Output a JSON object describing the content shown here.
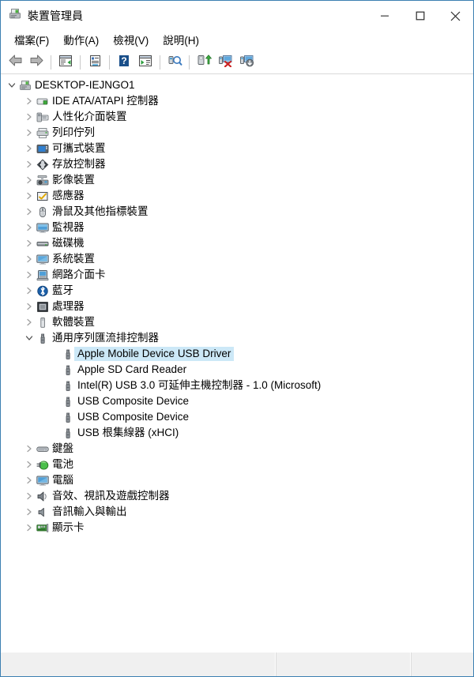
{
  "window": {
    "title": "裝置管理員",
    "icon": "device-manager-icon",
    "minimize_label": "—",
    "maximize_label": "□",
    "close_label": "✕"
  },
  "menubar": {
    "items": [
      {
        "label": "檔案(F)",
        "name": "menu-file"
      },
      {
        "label": "動作(A)",
        "name": "menu-action"
      },
      {
        "label": "檢視(V)",
        "name": "menu-view"
      },
      {
        "label": "說明(H)",
        "name": "menu-help"
      }
    ]
  },
  "toolbar": {
    "buttons": [
      {
        "icon": "back-arrow-icon",
        "name": "toolbar-back"
      },
      {
        "icon": "forward-arrow-icon",
        "name": "toolbar-forward"
      },
      {
        "separator": true
      },
      {
        "icon": "show-hide-console-tree-icon",
        "name": "toolbar-console-tree"
      },
      {
        "separator": true
      },
      {
        "icon": "properties-icon",
        "name": "toolbar-properties"
      },
      {
        "separator": true
      },
      {
        "icon": "help-icon",
        "name": "toolbar-help"
      },
      {
        "icon": "show-action-pane-icon",
        "name": "toolbar-action-pane"
      },
      {
        "separator": true
      },
      {
        "icon": "scan-for-hardware-changes-icon",
        "name": "toolbar-scan-hardware"
      },
      {
        "separator": true
      },
      {
        "icon": "update-driver-icon",
        "name": "toolbar-update-driver"
      },
      {
        "icon": "uninstall-device-icon",
        "name": "toolbar-uninstall-device"
      },
      {
        "icon": "disable-device-icon",
        "name": "toolbar-disable-device"
      }
    ]
  },
  "tree": {
    "root": {
      "label": "DESKTOP-IEJNGO1",
      "icon": "computer-tree-root-icon",
      "expanded": true
    },
    "nodes": [
      {
        "label": "IDE ATA/ATAPI 控制器",
        "icon": "ide-controller-icon",
        "level": 1,
        "expanded": false,
        "selected": false
      },
      {
        "label": "人性化介面裝置",
        "icon": "hid-device-icon",
        "level": 1,
        "expanded": false,
        "selected": false
      },
      {
        "label": "列印佇列",
        "icon": "print-queue-icon",
        "level": 1,
        "expanded": false,
        "selected": false
      },
      {
        "label": "可攜式裝置",
        "icon": "portable-device-icon",
        "level": 1,
        "expanded": false,
        "selected": false
      },
      {
        "label": "存放控制器",
        "icon": "storage-controller-icon",
        "level": 1,
        "expanded": false,
        "selected": false
      },
      {
        "label": "影像裝置",
        "icon": "imaging-device-icon",
        "level": 1,
        "expanded": false,
        "selected": false
      },
      {
        "label": "感應器",
        "icon": "sensor-icon",
        "level": 1,
        "expanded": false,
        "selected": false
      },
      {
        "label": "滑鼠及其他指標裝置",
        "icon": "mouse-icon",
        "level": 1,
        "expanded": false,
        "selected": false
      },
      {
        "label": "監視器",
        "icon": "monitor-icon",
        "level": 1,
        "expanded": false,
        "selected": false
      },
      {
        "label": "磁碟機",
        "icon": "disk-drive-icon",
        "level": 1,
        "expanded": false,
        "selected": false
      },
      {
        "label": "系統裝置",
        "icon": "system-device-icon",
        "level": 1,
        "expanded": false,
        "selected": false
      },
      {
        "label": "網路介面卡",
        "icon": "network-adapter-icon",
        "level": 1,
        "expanded": false,
        "selected": false
      },
      {
        "label": "藍牙",
        "icon": "bluetooth-icon",
        "level": 1,
        "expanded": false,
        "selected": false
      },
      {
        "label": "處理器",
        "icon": "processor-icon",
        "level": 1,
        "expanded": false,
        "selected": false
      },
      {
        "label": "軟體裝置",
        "icon": "software-device-icon",
        "level": 1,
        "expanded": false,
        "selected": false
      },
      {
        "label": "通用序列匯流排控制器",
        "icon": "usb-controller-icon",
        "level": 1,
        "expanded": true,
        "selected": false
      },
      {
        "label": "Apple Mobile Device USB Driver",
        "icon": "usb-device-icon",
        "level": 2,
        "expanded": null,
        "selected": true
      },
      {
        "label": "Apple SD Card Reader",
        "icon": "usb-device-icon",
        "level": 2,
        "expanded": null,
        "selected": false
      },
      {
        "label": "Intel(R) USB 3.0 可延伸主機控制器 - 1.0 (Microsoft)",
        "icon": "usb-device-icon",
        "level": 2,
        "expanded": null,
        "selected": false
      },
      {
        "label": "USB Composite Device",
        "icon": "usb-device-icon",
        "level": 2,
        "expanded": null,
        "selected": false
      },
      {
        "label": "USB Composite Device",
        "icon": "usb-device-icon",
        "level": 2,
        "expanded": null,
        "selected": false
      },
      {
        "label": "USB 根集線器 (xHCI)",
        "icon": "usb-device-icon",
        "level": 2,
        "expanded": null,
        "selected": false
      },
      {
        "label": "鍵盤",
        "icon": "keyboard-icon",
        "level": 1,
        "expanded": false,
        "selected": false
      },
      {
        "label": "電池",
        "icon": "battery-icon",
        "level": 1,
        "expanded": false,
        "selected": false
      },
      {
        "label": "電腦",
        "icon": "computer-icon",
        "level": 1,
        "expanded": false,
        "selected": false
      },
      {
        "label": "音效、視訊及遊戲控制器",
        "icon": "sound-video-game-controller-icon",
        "level": 1,
        "expanded": false,
        "selected": false
      },
      {
        "label": "音訊輸入與輸出",
        "icon": "audio-input-output-icon",
        "level": 1,
        "expanded": false,
        "selected": false
      },
      {
        "label": "顯示卡",
        "icon": "display-adapter-icon",
        "level": 1,
        "expanded": false,
        "selected": false
      }
    ]
  },
  "statusbar": {
    "panes": [
      "",
      "",
      ""
    ]
  },
  "colors": {
    "selection": "#cce8f7",
    "window_border": "#3c7fb1",
    "statusbar_bg": "#f0f0f0"
  }
}
